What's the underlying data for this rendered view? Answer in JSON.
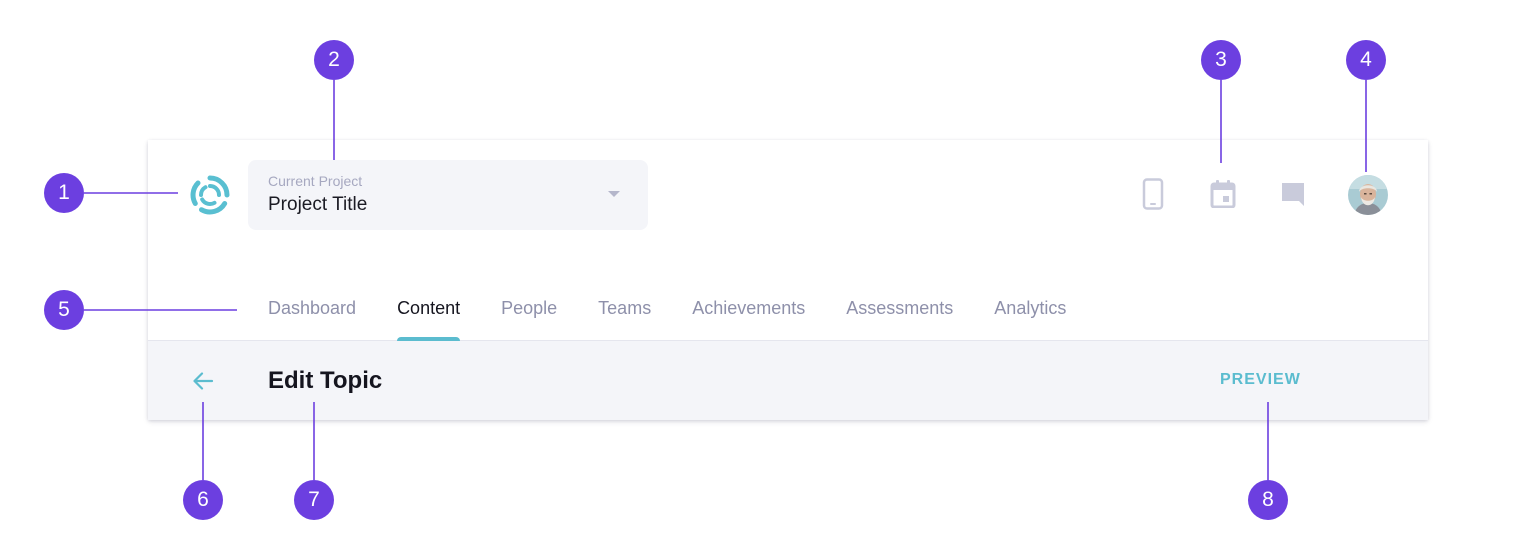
{
  "header": {
    "project_select": {
      "label": "Current Project",
      "value": "Project Title"
    },
    "icons": [
      "mobile-icon",
      "calendar-icon",
      "chat-icon"
    ],
    "avatar": "user-avatar"
  },
  "nav": {
    "tabs": [
      {
        "label": "Dashboard",
        "active": false
      },
      {
        "label": "Content",
        "active": true
      },
      {
        "label": "People",
        "active": false
      },
      {
        "label": "Teams",
        "active": false
      },
      {
        "label": "Achievements",
        "active": false
      },
      {
        "label": "Assessments",
        "active": false
      },
      {
        "label": "Analytics",
        "active": false
      }
    ]
  },
  "subheader": {
    "back_icon": "arrow-left-icon",
    "title": "Edit Topic",
    "preview_label": "PREVIEW"
  },
  "annotations": [
    "1",
    "2",
    "3",
    "4",
    "5",
    "6",
    "7",
    "8"
  ],
  "colors": {
    "accent": "#5bbccf",
    "annotation": "#6c3fe0",
    "muted_text": "#8e90aa",
    "icon_grey": "#c9cbdb",
    "subheader_bg": "#f4f5f9"
  }
}
